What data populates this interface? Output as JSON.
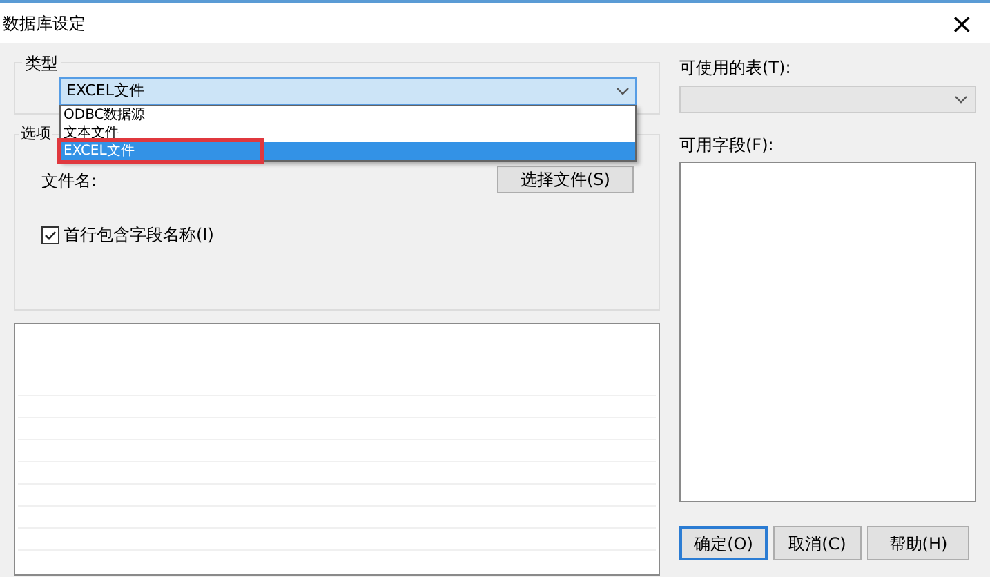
{
  "window": {
    "title": "数据库设定",
    "close": "×"
  },
  "type_group": {
    "label": "类型",
    "combo": {
      "value": "EXCEL文件",
      "expanded": true
    },
    "options": [
      {
        "label": "ODBC数据源",
        "selected": false
      },
      {
        "label": "文本文件",
        "selected": false
      },
      {
        "label": "EXCEL文件",
        "selected": true
      }
    ]
  },
  "options_group": {
    "label": "选项",
    "file_label": "文件名:",
    "choose_button": "选择文件(S)",
    "header_checkbox": {
      "label": "首行包含字段名称(I)",
      "checked": true
    }
  },
  "tables": {
    "label": "可使用的表(T):",
    "disabled": true
  },
  "fields": {
    "label": "可用字段(F):"
  },
  "buttons": [
    {
      "label": "确定(O)",
      "default": true
    },
    {
      "label": "取消(C)",
      "default": false
    },
    {
      "label": "帮助(H)",
      "default": false
    }
  ]
}
